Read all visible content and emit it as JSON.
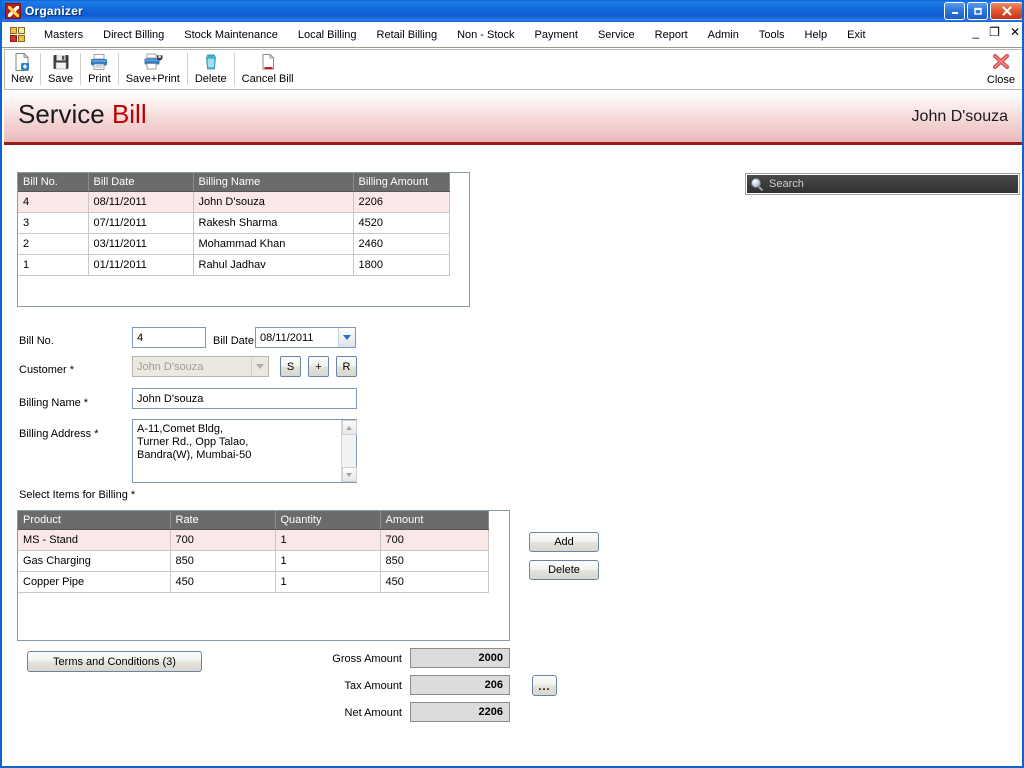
{
  "window": {
    "title": "Organizer",
    "icon": "app-icon",
    "minimize_label": "_",
    "maximize_label": "□",
    "close_label": "✕"
  },
  "menubar": {
    "items": [
      "Masters",
      "Direct Billing",
      "Stock Maintenance",
      "Local Billing",
      "Retail Billing",
      "Non - Stock",
      "Payment",
      "Service",
      "Report",
      "Admin",
      "Tools",
      "Help",
      "Exit"
    ],
    "mdi": {
      "minimize": "_",
      "restore": "❐",
      "close": "✕"
    }
  },
  "toolbar": {
    "items": [
      {
        "label": "New",
        "icon": "new-document-icon"
      },
      {
        "label": "Save",
        "icon": "floppy-disk-icon"
      },
      {
        "label": "Print",
        "icon": "printer-icon"
      },
      {
        "label": "Save+Print",
        "icon": "save-and-print-icon"
      },
      {
        "label": "Delete",
        "icon": "trash-can-icon"
      },
      {
        "label": "Cancel Bill",
        "icon": "cancel-document-icon"
      }
    ],
    "close": {
      "label": "Close",
      "icon": "red-x-icon"
    }
  },
  "banner": {
    "title_primary": "Service",
    "title_secondary": "Bill",
    "user": "John D'souza",
    "accent_color": "#9e1a1a",
    "secondary_color": "#c00000"
  },
  "search": {
    "placeholder": "Search",
    "value": "",
    "icon": "magnifier-icon"
  },
  "bills_grid": {
    "columns": [
      "Bill No.",
      "Bill Date",
      "Billing Name",
      "Billing Amount"
    ],
    "rows": [
      {
        "cells": [
          "4",
          "08/11/2011",
          "John D'souza",
          "2206"
        ],
        "selected": true
      },
      {
        "cells": [
          "3",
          "07/11/2011",
          "Rakesh Sharma",
          "4520"
        ],
        "selected": false
      },
      {
        "cells": [
          "2",
          "03/11/2011",
          "Mohammad Khan",
          "2460"
        ],
        "selected": false
      },
      {
        "cells": [
          "1",
          "01/11/2011",
          "Rahul Jadhav",
          "1800"
        ],
        "selected": false
      }
    ]
  },
  "form": {
    "bill_no_label": "Bill No.",
    "bill_no_value": "4",
    "bill_date_label": "Bill Date",
    "bill_date_value": "08/11/2011",
    "customer_label": "Customer *",
    "customer_value": "John D'souza",
    "customer_buttons": [
      "S",
      "+",
      "R"
    ],
    "billing_name_label": "Billing Name *",
    "billing_name_value": "John D'souza",
    "billing_address_label": "Billing Address *",
    "billing_address_value": "A-11,Comet Bldg,\nTurner Rd., Opp Talao,\nBandra(W), Mumbai-50"
  },
  "items_section": {
    "heading": "Select Items for Billing *",
    "columns": [
      "Product",
      "Rate",
      "Quantity",
      "Amount"
    ],
    "rows": [
      {
        "cells": [
          "MS - Stand",
          "700",
          "1",
          "700"
        ],
        "selected": true
      },
      {
        "cells": [
          "Gas Charging",
          "850",
          "1",
          "850"
        ],
        "selected": false
      },
      {
        "cells": [
          "Copper Pipe",
          "450",
          "1",
          "450"
        ],
        "selected": false
      }
    ],
    "add_label": "Add",
    "delete_label": "Delete"
  },
  "footer": {
    "terms_label": "Terms and Conditions (3)",
    "gross_label": "Gross Amount",
    "gross_value": "2000",
    "tax_label": "Tax Amount",
    "tax_value": "206",
    "net_label": "Net Amount",
    "net_value": "2206",
    "ellipsis_label": "..."
  }
}
